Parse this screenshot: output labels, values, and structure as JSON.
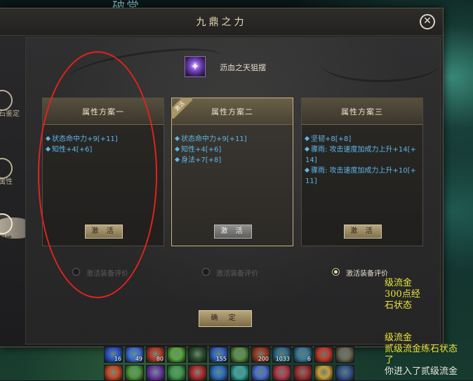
{
  "background": {
    "top_text": "破常"
  },
  "window": {
    "title": "九鼎之力",
    "close_glyph": "✕"
  },
  "sidebar": {
    "items": [
      {
        "label": "石鉴定"
      },
      {
        "label": "属性"
      },
      {
        "label": "属性"
      }
    ]
  },
  "item": {
    "name": "沥血之天狙摆"
  },
  "cards": [
    {
      "title": "属性方案一",
      "attrs": [
        "状态命中力+9[+11]",
        "知性+4[+6]"
      ],
      "button": "激 活"
    },
    {
      "title": "属性方案二",
      "badge": "激活",
      "attrs": [
        "状态命中力+9[+11]",
        "知性+4[+6]",
        "身法+7[+8]"
      ],
      "button": "激 活"
    },
    {
      "title": "属性方案三",
      "attrs": [
        "坚韧+8[+8]",
        "骤雨: 攻击速度加成力上升+14[+14]",
        "骤雨: 攻击速度加成力上升+10[+11]"
      ],
      "button": "激 活"
    }
  ],
  "radios": [
    {
      "label": "激活装备评价",
      "checked": false
    },
    {
      "label": "激活装备评价",
      "checked": false
    },
    {
      "label": "激活装备评价",
      "checked": true
    }
  ],
  "confirm": "确 定",
  "chat": {
    "lines": [
      {
        "text": "级流金",
        "color": "yellow"
      },
      {
        "text": "300点经",
        "color": "yellow"
      },
      {
        "text": "石状态",
        "color": "yellow"
      },
      {
        "text": "级流金",
        "color": "yellow"
      },
      {
        "text": "贰级流金练石状态",
        "color": "yellow"
      },
      {
        "text": "了",
        "color": "yellow"
      },
      {
        "text": "你进入了贰级流金",
        "color": "white"
      }
    ]
  },
  "skillbar": {
    "slots": [
      {
        "count": "16",
        "color": "#2b55c9"
      },
      {
        "count": "49",
        "color": "#3a6fd6"
      },
      {
        "count": "80",
        "color": "#b23a2a"
      },
      {
        "count": "",
        "color": "#58a83a"
      },
      {
        "count": "",
        "color": "#2e4f2c"
      },
      {
        "count": "155",
        "color": "#3565c4"
      },
      {
        "count": "",
        "color": "#5a8f44"
      },
      {
        "count": "200",
        "color": "#9a3a26"
      },
      {
        "count": "1033",
        "color": "#2e6e8a"
      },
      {
        "count": "6",
        "color": "#3b7a9c"
      },
      {
        "count": "",
        "color": "#c23b2a"
      },
      {
        "count": "",
        "color": "#6d6b55"
      },
      {
        "count": "",
        "color": "#c94a2a"
      },
      {
        "count": "",
        "color": "#4e9a3b"
      },
      {
        "count": "",
        "color": "#6b3aa8"
      },
      {
        "count": "",
        "color": "#3e9a4a"
      },
      {
        "count": "",
        "color": "#b02a30"
      },
      {
        "count": "",
        "color": "#2c6ec0"
      },
      {
        "count": "",
        "color": "#35a6a0"
      },
      {
        "count": "",
        "color": "#4b6fd0"
      },
      {
        "count": "",
        "color": "#b63a4a"
      },
      {
        "count": "",
        "color": "#a23232"
      },
      {
        "count": "",
        "color": "#c9a03a"
      },
      {
        "count": "",
        "color": "#36558f"
      }
    ]
  },
  "colors": {
    "attr_text": "#5fb7e8",
    "annotation": "#e3221c",
    "chat_yellow": "#e8e43a"
  }
}
